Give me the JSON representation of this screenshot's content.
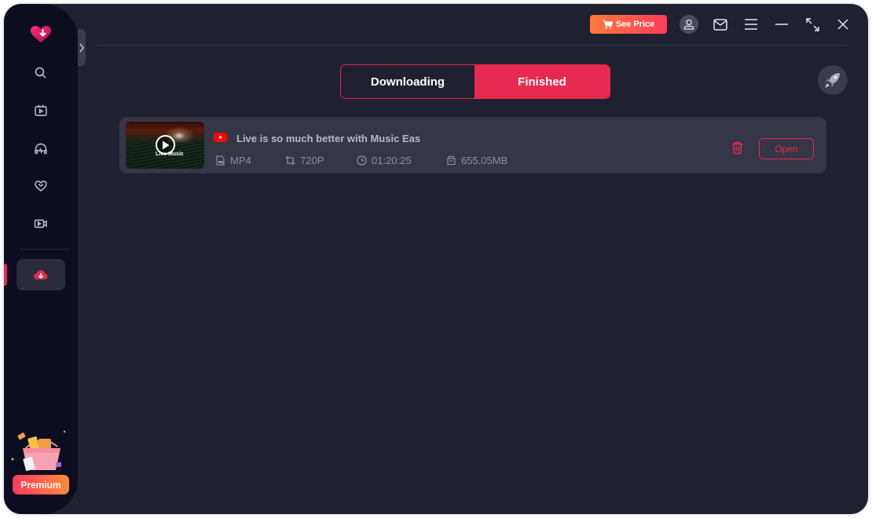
{
  "app": {
    "accent_color": "#e8294f",
    "background_color": "#1f2030",
    "sidebar_color": "#0d0d20"
  },
  "sidebar": {
    "logo": "heart-download-logo",
    "items": [
      {
        "name": "search",
        "icon": "search-icon"
      },
      {
        "name": "video",
        "icon": "tv-play-icon"
      },
      {
        "name": "music",
        "icon": "headphones-icon"
      },
      {
        "name": "favorites",
        "icon": "heart-icon"
      },
      {
        "name": "record",
        "icon": "video-camera-icon"
      },
      {
        "name": "downloads",
        "icon": "cloud-download-icon",
        "active": true
      }
    ],
    "premium_label": "Premium"
  },
  "titlebar": {
    "see_price_label": "See Price",
    "icons": [
      "user-icon",
      "mail-icon",
      "menu-icon",
      "minimize-icon",
      "maximize-icon",
      "close-icon"
    ]
  },
  "tabs": [
    {
      "label": "Downloading",
      "active": false
    },
    {
      "label": "Finished",
      "active": true
    }
  ],
  "downloads": [
    {
      "source": "youtube",
      "title": "Live is so much better with Music Eas",
      "thumbnail_text": "Live Music",
      "format": "MP4",
      "resolution": "720P",
      "duration": "01:20:25",
      "size": "655.05MB",
      "open_label": "Open"
    }
  ]
}
